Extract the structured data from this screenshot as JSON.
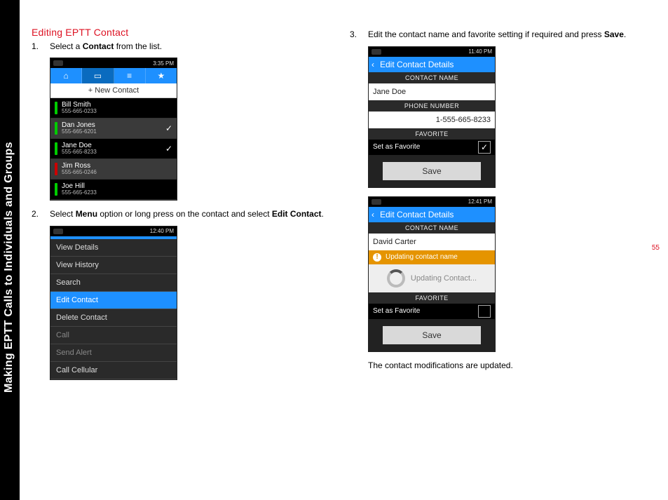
{
  "sidebar": {
    "text": "Making EPTT Calls to Individuals and Groups"
  },
  "page_number": "55",
  "heading": "Editing EPTT Contact",
  "steps": {
    "s1": {
      "num": "1.",
      "text_a": "Select a ",
      "bold_a": "Contact",
      "text_b": " from the list."
    },
    "s2": {
      "num": "2.",
      "text_a": "Select ",
      "bold_a": "Menu",
      "text_b": " option or long press on the contact and select ",
      "bold_b": "Edit Contact",
      "text_c": "."
    },
    "s3": {
      "num": "3.",
      "text_a": "Edit the contact name and favorite setting if required and press ",
      "bold_a": "Save",
      "text_b": "."
    }
  },
  "closing": "The contact modifications are updated.",
  "shot1": {
    "time": "3:35 PM",
    "icons": {
      "home": "⌂",
      "card": "▭",
      "list": "≡",
      "star": "★"
    },
    "new_contact": "+ New Contact",
    "rows": [
      {
        "name": "Bill Smith",
        "ph": "555-665-0233",
        "pres": "green",
        "checked": false
      },
      {
        "name": "Dan Jones",
        "ph": "555-665-6201",
        "pres": "green",
        "checked": true
      },
      {
        "name": "Jane Doe",
        "ph": "555-665-8233",
        "pres": "green",
        "checked": true
      },
      {
        "name": "Jim Ross",
        "ph": "555-665-0246",
        "pres": "red",
        "checked": false
      },
      {
        "name": "Joe Hill",
        "ph": "555-665-6233",
        "pres": "green",
        "checked": false
      }
    ]
  },
  "shot2": {
    "time": "12:40 PM",
    "items": [
      {
        "label": "View Details"
      },
      {
        "label": "View History"
      },
      {
        "label": "Search"
      },
      {
        "label": "Edit Contact",
        "sel": true
      },
      {
        "label": "Delete Contact"
      },
      {
        "label": "Call",
        "dis": true
      },
      {
        "label": "Send Alert",
        "dis": true
      },
      {
        "label": "Call Cellular"
      }
    ]
  },
  "shot3": {
    "time": "11:40 PM",
    "title": "Edit Contact Details",
    "labels": {
      "name": "CONTACT NAME",
      "phone": "PHONE NUMBER",
      "fav": "FAVORITE"
    },
    "name_value": "Jane Doe",
    "phone_value": "1-555-665-8233",
    "fav_label": "Set as Favorite",
    "fav_checked": "✓",
    "save": "Save"
  },
  "shot4": {
    "time": "12:41 PM",
    "title": "Edit Contact Details",
    "labels": {
      "name": "CONTACT NAME",
      "fav": "FAVORITE"
    },
    "name_value": "David Carter",
    "notify": "Updating contact name",
    "loading": "Updating Contact...",
    "fav_label": "Set as Favorite",
    "save": "Save"
  }
}
